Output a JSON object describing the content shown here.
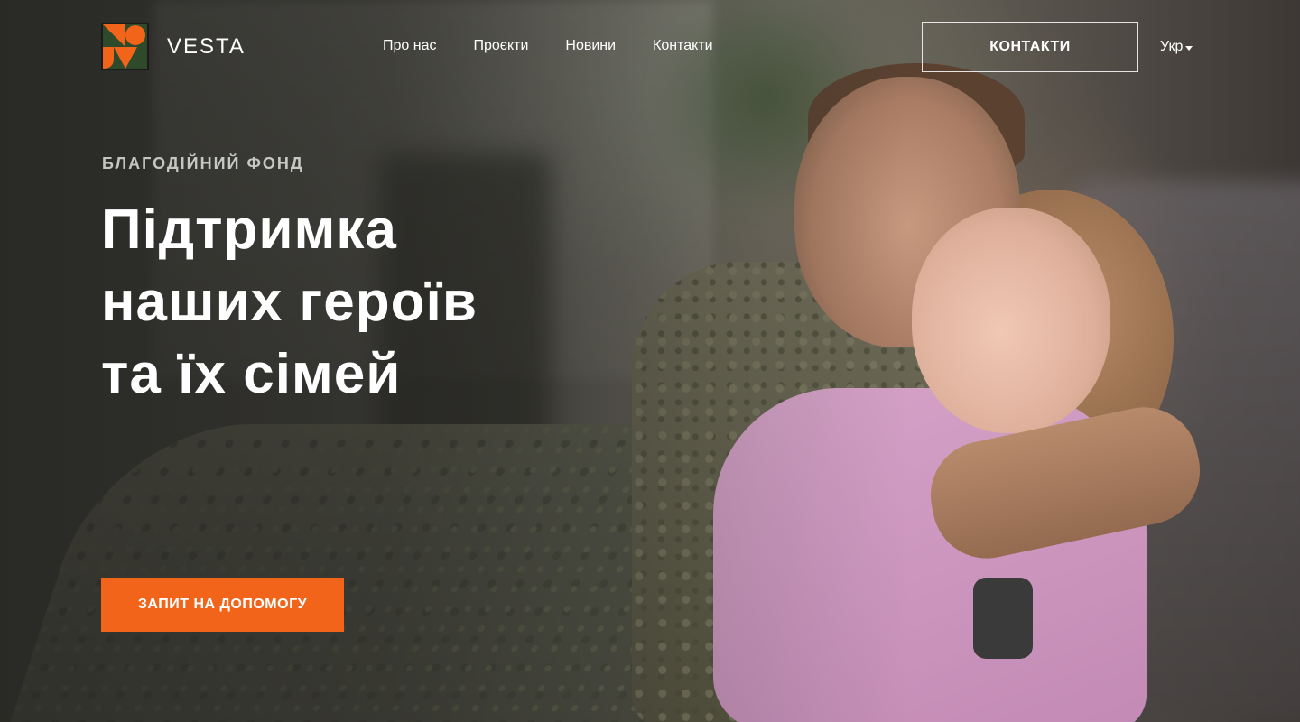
{
  "header": {
    "logo_text": "VESTA",
    "nav": [
      {
        "label": "Про нас"
      },
      {
        "label": "Проєкти"
      },
      {
        "label": "Новини"
      },
      {
        "label": "Контакти"
      }
    ],
    "contact_button": "КОНТАКТИ",
    "language": "Укр"
  },
  "hero": {
    "eyebrow": "БЛАГОДІЙНИЙ ФОНД",
    "headline_lines": [
      "Підтримка",
      "наших героїв",
      "та їх сімей"
    ],
    "cta": "ЗАПИТ НА ДОПОМОГУ"
  },
  "colors": {
    "accent": "#f26419",
    "logo_green": "#2f4a2a",
    "logo_orange": "#f26419"
  },
  "icons": {
    "logo": "vesta-logo-icon",
    "language_dropdown": "caret-down-icon"
  }
}
